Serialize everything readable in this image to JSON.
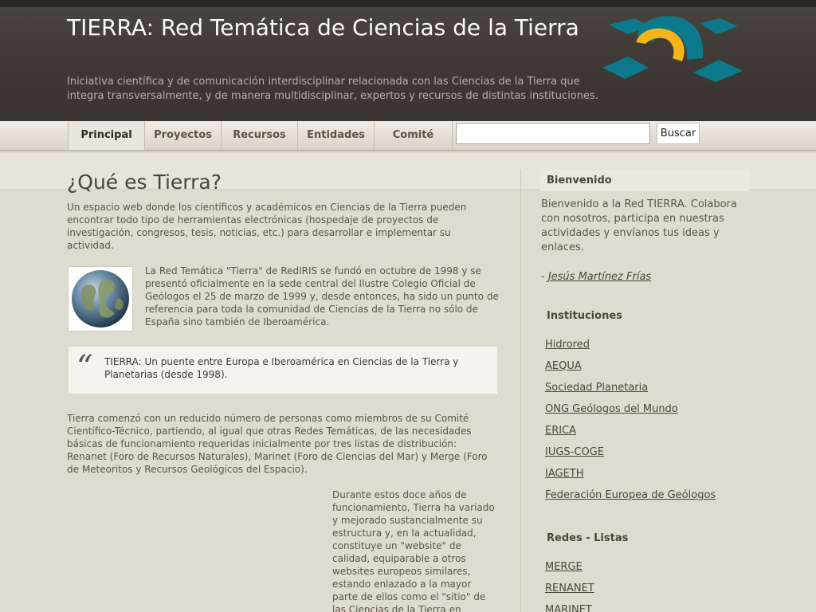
{
  "header": {
    "title": "TIERRA: Red Temática de Ciencias de la Tierra",
    "tagline": "Iniciativa científica y de comunicación interdisciplinar relacionada con las Ciencias de la Tierra que integra transversalmente, y de manera multidisciplinar, expertos y recursos de distintas instituciones."
  },
  "nav": {
    "items": [
      {
        "label": "Principal"
      },
      {
        "label": "Proyectos"
      },
      {
        "label": "Recursos"
      },
      {
        "label": "Entidades"
      },
      {
        "label": "Comité"
      }
    ],
    "search_value": "",
    "search_button": "Buscar"
  },
  "main": {
    "title": "¿Qué es Tierra?",
    "intro": "Un espacio web donde los científicos y académicos en Ciencias de la Tierra pueden encontrar todo tipo de herramientas electrónicas (hospedaje de proyectos de investigación, congresos, tesis, noticias, etc.) para desarrollar e implementar su actividad.",
    "history": "La Red Temática \"Tierra\" de RedIRIS se fundó en octubre de 1998 y se presentó oficialmente en la sede central del Ilustre Colegio Oficial de Geólogos el 25 de marzo de 1999 y, desde entonces, ha sido un punto de referencia para toda la comunidad de Ciencias de la Tierra no sólo de España sino también de Iberoamérica.",
    "quote": "TIERRA: Un puente entre Europa e Iberoamérica en Ciencias de la Tierra y Planetarias (desde 1998).",
    "origin": "Tierra comenzó con un reducido número de personas como miembros de su Comité Científico-Técnico, partiendo, al igual que otras Redes Temáticas, de las necesidades básicas de funcionamiento  requeridas inicialmente por tres listas de distribución: Renanet (Foro de Recursos Naturales), Marinet (Foro de Ciencias del Mar) y Merge (Foro de Meteoritos y Recursos Geológicos del Espacio).",
    "evolution": "Durante estos doce años de funcionamiento, Tierra ha variado y mejorado sustancialmente su estructura y, en la actualidad, constituye un \"website\" de calidad, equiparable a otros websites europeos similares, estando enlazado a la mayor parte de ellos como el \"sitio\" de las Ciencias de la Tierra en"
  },
  "sidebar": {
    "welcome_title": "Bienvenido",
    "welcome_text": "Bienvenido a la Red TIERRA. Colabora con nosotros, participa en nuestras actividades y envíanos tus ideas y enlaces.",
    "welcome_link": " ",
    "author_prefix": "- ",
    "author": "Jesús Martínez Frías",
    "institutions_title": "Instituciones",
    "institutions": [
      "Hidrored",
      "AEQUA",
      "Sociedad Planetaria",
      "ONG Geólogos del Mundo",
      "ERICA",
      "IUGS-COGE",
      "IAGETH",
      "Federación Europea de Geólogos"
    ],
    "lists_title": "Redes - Listas",
    "lists": [
      "MERGE",
      "RENANET",
      "MARINET"
    ]
  },
  "colors": {
    "header_bg": "#3f3a35",
    "logo_teal": "#0c7a8c",
    "logo_yellow": "#f4b41a"
  }
}
